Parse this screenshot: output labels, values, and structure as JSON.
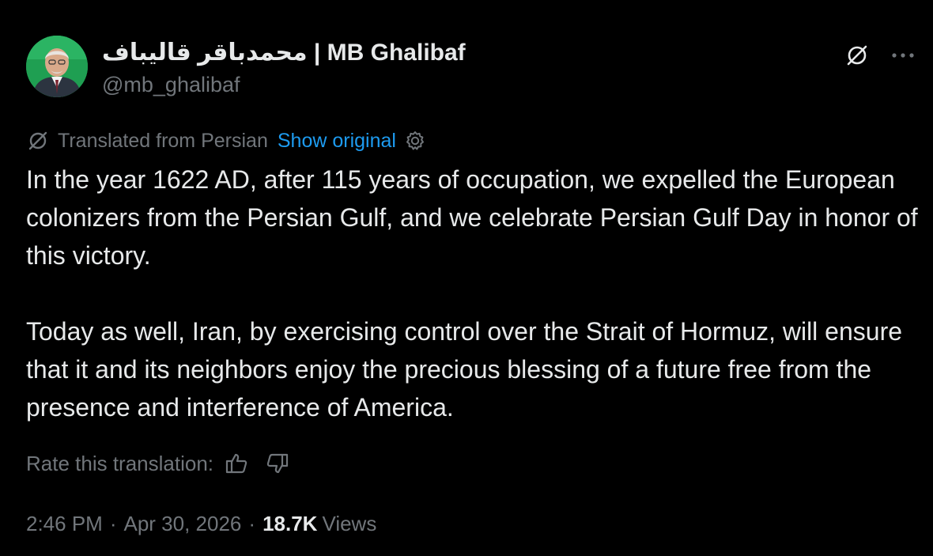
{
  "author": {
    "display_name": "محمدباقر قالیباف | MB Ghalibaf",
    "handle": "@mb_ghalibaf",
    "avatar_icon": "portrait-avatar"
  },
  "header_actions": {
    "translate_icon": "translate-icon",
    "more_icon": "more-options-icon"
  },
  "translation": {
    "label": "Translated from Persian",
    "show_original": "Show original",
    "settings_icon": "gear-icon"
  },
  "tweet": {
    "paragraphs": [
      "In the year 1622 AD, after 115 years of occupation, we expelled the European colonizers from the Persian Gulf, and we celebrate Persian Gulf Day in honor of this victory.",
      "Today as well, Iran, by exercising control over the Strait of Hormuz, will ensure that it and its neighbors enjoy the precious blessing of a future free from the presence and interference of America."
    ]
  },
  "rating": {
    "label": "Rate this translation:",
    "up_icon": "thumbs-up-icon",
    "down_icon": "thumbs-down-icon"
  },
  "meta": {
    "time": "2:46 PM",
    "separator": "·",
    "date": "Apr 30, 2026",
    "views_count": "18.7K",
    "views_label": "Views"
  },
  "colors": {
    "background": "#000000",
    "primary_text": "#e7e9ea",
    "secondary_text": "#71767b",
    "link": "#1d9bf0"
  }
}
